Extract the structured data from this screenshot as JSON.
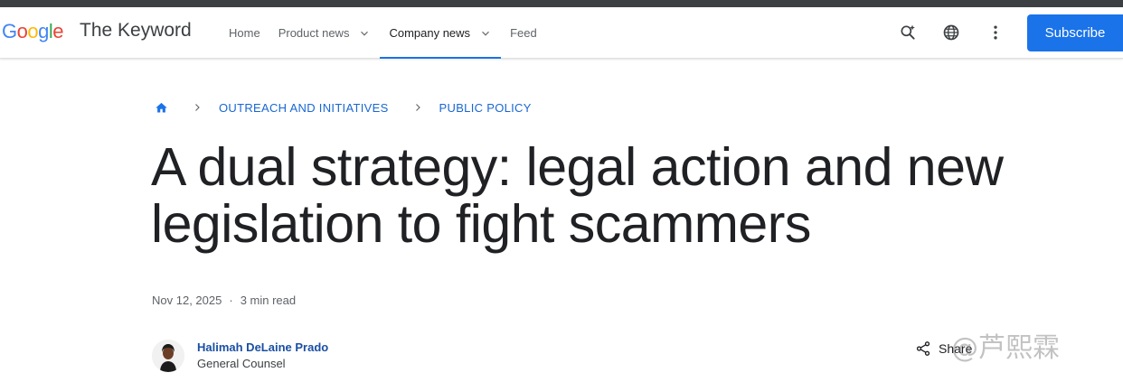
{
  "header": {
    "logo_letters": [
      {
        "ch": "G",
        "color": "#4285F4"
      },
      {
        "ch": "o",
        "color": "#EA4335"
      },
      {
        "ch": "o",
        "color": "#FBBC05"
      },
      {
        "ch": "g",
        "color": "#4285F4"
      },
      {
        "ch": "l",
        "color": "#34A853"
      },
      {
        "ch": "e",
        "color": "#EA4335"
      }
    ],
    "brand": "The Keyword",
    "nav": {
      "home": "Home",
      "product_news": "Product news",
      "company_news": "Company news",
      "feed": "Feed"
    },
    "subscribe_label": "Subscribe",
    "icons": [
      "search-sparkle-icon",
      "globe-icon",
      "more-vert-icon"
    ]
  },
  "breadcrumb": {
    "home_icon": "home-icon",
    "items": [
      "OUTREACH AND INITIATIVES",
      "PUBLIC POLICY"
    ]
  },
  "article": {
    "title_line1": "A dual strategy: legal action and new",
    "title_line2": "legislation to fight scammers",
    "date": "Nov 12, 2025",
    "separator": "·",
    "read_time": "3 min read",
    "author_name": "Halimah DeLaine Prado",
    "author_role": "General Counsel",
    "share_label": "Share"
  },
  "watermark": "@芦熙霖",
  "colors": {
    "accent": "#1a73e8",
    "link": "#1967d2"
  }
}
